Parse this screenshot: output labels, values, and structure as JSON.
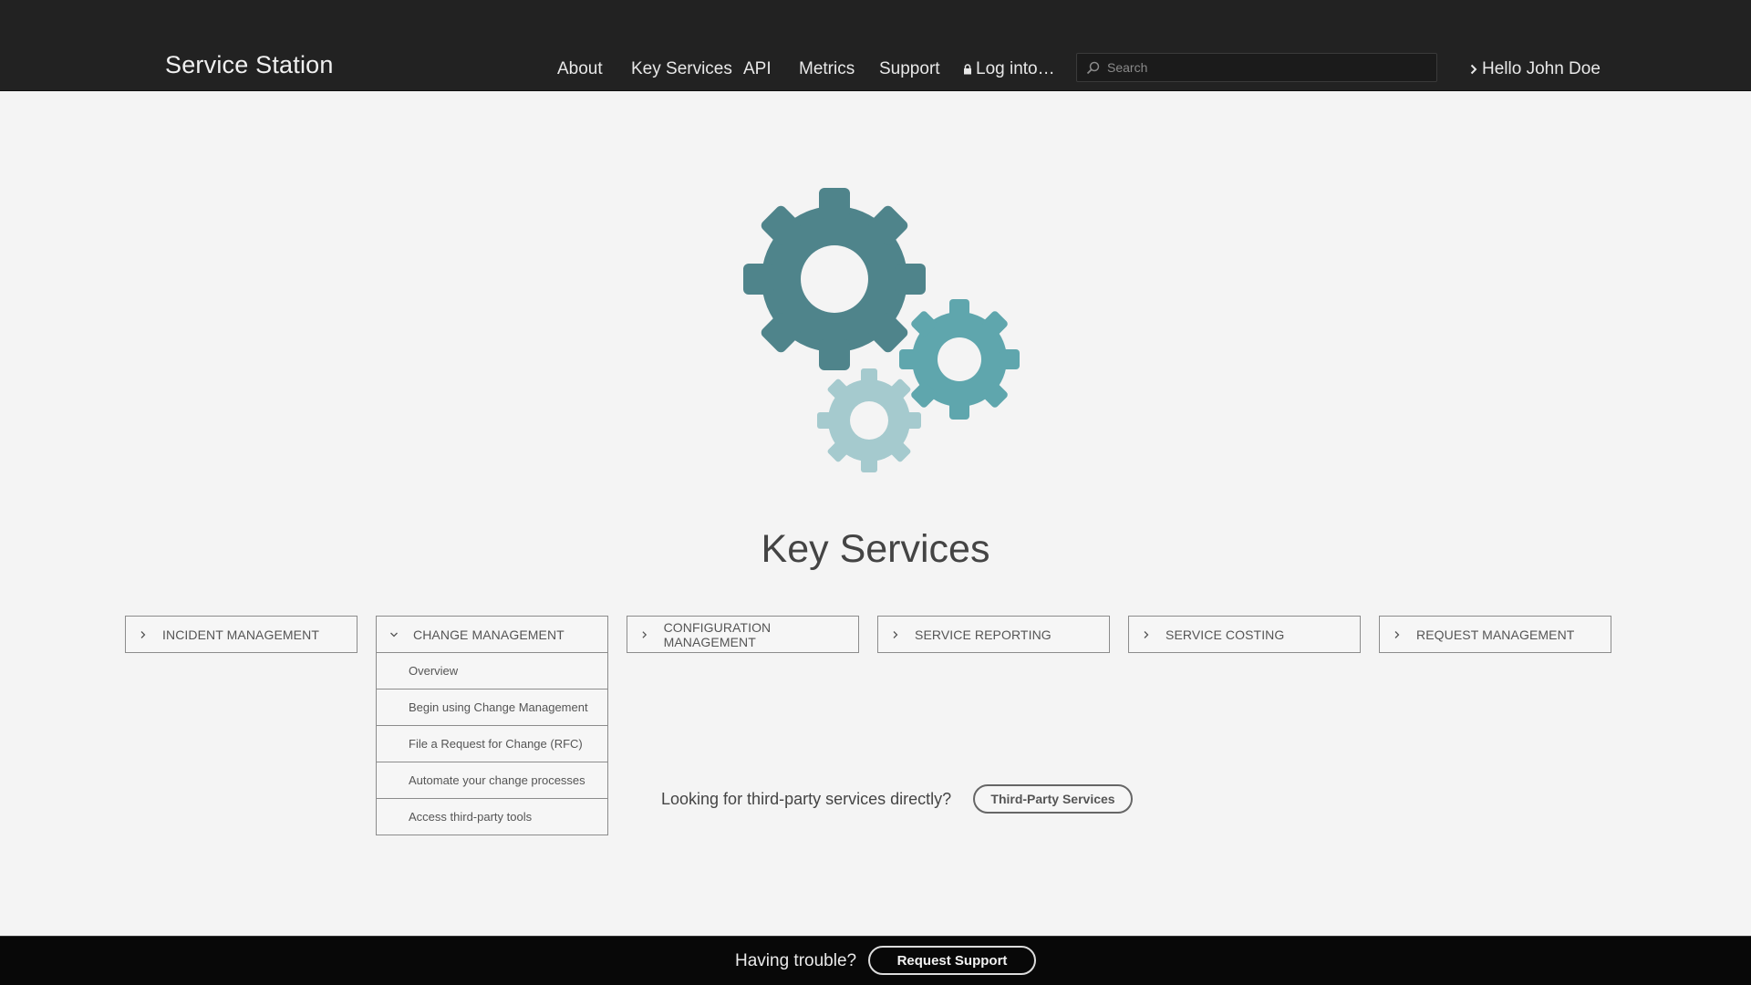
{
  "header": {
    "brand": "Service Station",
    "nav": {
      "about": "About",
      "key_services": "Key Services",
      "api": "API",
      "metrics": "Metrics",
      "support": "Support",
      "login": "Log into…"
    },
    "search": {
      "placeholder": "Search"
    },
    "user": "Hello John Doe"
  },
  "hero": {
    "title": "Key Services",
    "gear_colors": [
      "#4f848b",
      "#5fa6ad",
      "#a5cace"
    ]
  },
  "services": [
    {
      "label": "INCIDENT MANAGEMENT",
      "expanded": false
    },
    {
      "label": "CHANGE MANAGEMENT",
      "expanded": true,
      "items": [
        "Overview",
        "Begin using Change Management",
        "File a Request for Change (RFC)",
        "Automate your change processes",
        "Access third-party tools"
      ]
    },
    {
      "label": "CONFIGURATION MANAGEMENT",
      "expanded": false
    },
    {
      "label": "SERVICE REPORTING",
      "expanded": false
    },
    {
      "label": "SERVICE COSTING",
      "expanded": false
    },
    {
      "label": "REQUEST MANAGEMENT",
      "expanded": false
    }
  ],
  "third_party": {
    "prompt": "Looking for third-party services directly?",
    "button": "Third-Party Services"
  },
  "footer": {
    "prompt": "Having trouble?",
    "button": "Request Support"
  }
}
